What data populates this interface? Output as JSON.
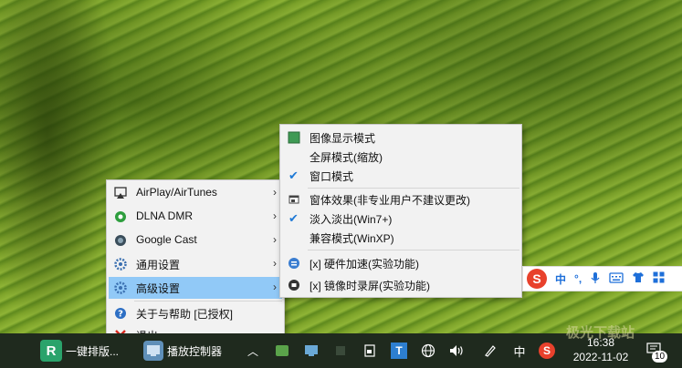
{
  "main_menu": {
    "items": [
      {
        "label": "AirPlay/AirTunes",
        "icon": "airplay-icon",
        "has_submenu": true
      },
      {
        "label": "DLNA DMR",
        "icon": "dlna-icon",
        "has_submenu": true
      },
      {
        "label": "Google Cast",
        "icon": "cast-icon",
        "has_submenu": true
      },
      {
        "label": "通用设置",
        "icon": "gear-icon",
        "has_submenu": true
      },
      {
        "label": "高级设置",
        "icon": "advanced-gear-icon",
        "has_submenu": true,
        "active": true
      },
      {
        "label": "关于与帮助 [已授权]",
        "icon": "help-icon",
        "has_submenu": false
      },
      {
        "label": "退出",
        "icon": "exit-icon",
        "has_submenu": false
      }
    ]
  },
  "sub_menu": {
    "items": [
      {
        "label": "图像显示模式",
        "icon": "image-mode-icon",
        "checked": false
      },
      {
        "label": "全屏模式(缩放)",
        "checked": false
      },
      {
        "label": "窗口模式",
        "checked": true
      },
      {
        "label": "窗体效果(非专业用户不建议更改)",
        "icon": "window-effect-icon",
        "checked": false
      },
      {
        "label": "淡入淡出(Win7+)",
        "checked": true
      },
      {
        "label": "兼容模式(WinXP)",
        "checked": false
      },
      {
        "label": "[x] 硬件加速(实验功能)",
        "icon": "hardware-accel-icon"
      },
      {
        "label": "[x] 镜像时录屏(实验功能)",
        "icon": "record-icon"
      }
    ]
  },
  "ime_bar": {
    "logo": "S",
    "lang": "中",
    "punct": "°,",
    "icons": [
      "mic-icon",
      "keyboard-icon",
      "shirt-icon",
      "grid-icon"
    ]
  },
  "taskbar": {
    "app1_label": "一键排版...",
    "app2_label": "播放控制器",
    "app1_icon_text": "R",
    "tray_lang": "中",
    "tray_t": "T",
    "notification_count": "10",
    "time": "16:38",
    "date": "2022-11-02"
  },
  "watermark": "极光下载站"
}
